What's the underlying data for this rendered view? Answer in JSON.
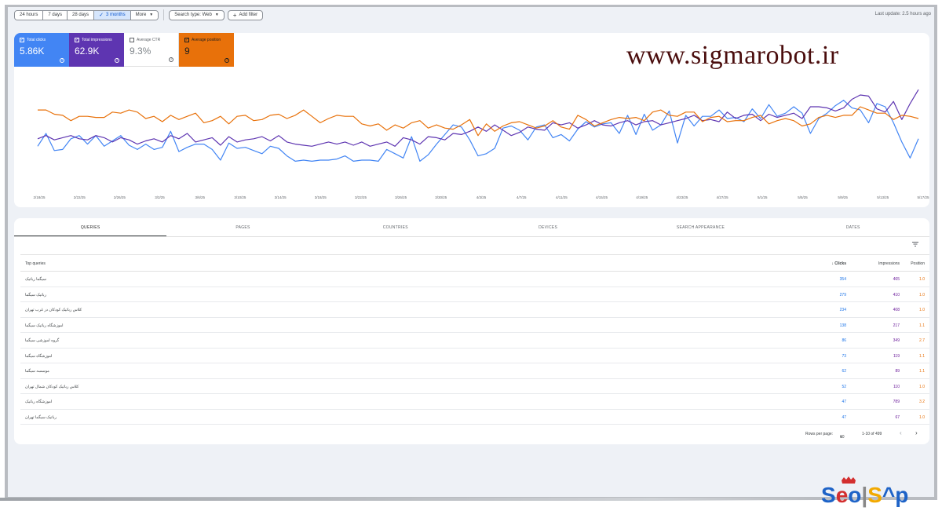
{
  "toolbar": {
    "ranges": [
      "24 hours",
      "7 days",
      "28 days",
      "3 months",
      "More"
    ],
    "active_range": "3 months",
    "search_type": "Search type: Web",
    "add_filter": "Add filter",
    "last_update": "Last update: 2.5 hours ago"
  },
  "metrics": [
    {
      "label": "Total clicks",
      "value": "5.86K",
      "color": "#4285f4",
      "checked": true
    },
    {
      "label": "Total impressions",
      "value": "62.9K",
      "color": "#5e35b1",
      "checked": true
    },
    {
      "label": "Average CTR",
      "value": "9.3%",
      "color": "#00897b",
      "checked": false
    },
    {
      "label": "Average position",
      "value": "9",
      "color": "#e8710a",
      "checked": true
    }
  ],
  "watermark": "www.sigmarobot.ir",
  "chart_data": {
    "type": "line",
    "x_tick_labels": [
      "2/18/25",
      "2/22/25",
      "2/26/25",
      "3/2/25",
      "3/6/25",
      "3/10/25",
      "3/14/25",
      "3/18/25",
      "3/22/25",
      "3/26/25",
      "3/30/25",
      "4/3/25",
      "4/7/25",
      "4/11/25",
      "4/15/25",
      "4/19/25",
      "4/23/25",
      "4/27/25",
      "5/1/25",
      "5/5/25",
      "5/9/25",
      "5/13/25",
      "5/17/25"
    ],
    "series": [
      {
        "color": "#4285f4",
        "values": [
          62,
          50,
          66,
          65,
          55,
          52,
          60,
          52,
          62,
          57,
          52,
          61,
          65,
          60,
          65,
          63,
          48,
          67,
          63,
          60,
          60,
          65,
          75,
          59,
          64,
          63,
          66,
          69,
          62,
          64,
          71,
          76,
          75,
          76,
          75,
          75,
          74,
          71,
          76,
          75,
          75,
          76,
          65,
          69,
          73,
          53,
          76,
          70,
          60,
          51,
          42,
          44,
          56,
          71,
          69,
          64,
          45,
          43,
          47,
          56,
          44,
          42,
          54,
          51,
          57,
          46,
          39,
          44,
          41,
          40,
          50,
          33,
          51,
          32,
          47,
          42,
          29,
          59,
          33,
          43,
          34,
          34,
          28,
          36,
          35,
          39,
          27,
          36,
          23,
          34,
          31,
          25,
          31,
          50,
          36,
          31,
          24,
          19,
          26,
          28,
          40,
          22,
          25,
          40,
          58,
          73,
          55
        ]
      },
      {
        "color": "#5e35b1",
        "values": [
          55,
          52,
          56,
          54,
          52,
          55,
          56,
          52,
          54,
          58,
          54,
          56,
          60,
          57,
          55,
          58,
          52,
          55,
          50,
          58,
          56,
          54,
          61,
          53,
          58,
          56,
          55,
          53,
          57,
          52,
          58,
          60,
          61,
          62,
          60,
          58,
          60,
          58,
          61,
          58,
          62,
          60,
          58,
          62,
          54,
          56,
          60,
          53,
          54,
          56,
          50,
          51,
          48,
          44,
          48,
          42,
          47,
          52,
          49,
          44,
          46,
          47,
          40,
          42,
          40,
          45,
          42,
          38,
          42,
          43,
          40,
          38,
          42,
          39,
          38,
          42,
          40,
          38,
          36,
          33,
          38,
          37,
          39,
          30,
          36,
          33,
          32,
          38,
          32,
          35,
          33,
          31,
          36,
          25,
          25,
          26,
          29,
          26,
          18,
          14,
          15,
          27,
          30,
          20,
          37,
          22,
          9
        ]
      },
      {
        "color": "#e8710a",
        "values": [
          28,
          28,
          32,
          33,
          38,
          34,
          34,
          35,
          35,
          30,
          31,
          28,
          30,
          36,
          34,
          39,
          33,
          37,
          34,
          31,
          40,
          38,
          34,
          41,
          34,
          33,
          38,
          37,
          33,
          32,
          36,
          33,
          28,
          34,
          40,
          36,
          33,
          34,
          34,
          41,
          43,
          41,
          47,
          42,
          45,
          40,
          38,
          45,
          42,
          45,
          46,
          42,
          37,
          52,
          41,
          48,
          43,
          40,
          39,
          42,
          45,
          43,
          38,
          44,
          46,
          33,
          37,
          43,
          40,
          37,
          35,
          36,
          35,
          38,
          30,
          28,
          33,
          34,
          30,
          30,
          39,
          35,
          34,
          39,
          38,
          38,
          35,
          33,
          41,
          38,
          36,
          38,
          43,
          41,
          35,
          33,
          35,
          33,
          33,
          25,
          28,
          31,
          31,
          37,
          33,
          34,
          36
        ]
      }
    ]
  },
  "tabs": [
    "QUERIES",
    "PAGES",
    "COUNTRIES",
    "DEVICES",
    "SEARCH APPEARANCE",
    "DATES"
  ],
  "table": {
    "headers": {
      "query": "Top queries",
      "clicks": "Clicks",
      "impressions": "Impressions",
      "position": "Position"
    },
    "rows": [
      {
        "query": "سیگما رباتیک",
        "clicks": "354",
        "impressions": "465",
        "position": "1.0"
      },
      {
        "query": "رباتیک سیگما",
        "clicks": "279",
        "impressions": "410",
        "position": "1.0"
      },
      {
        "query": "کلاس رباتیک کودکان در غرب تهران",
        "clicks": "234",
        "impressions": "408",
        "position": "1.0"
      },
      {
        "query": "اموزشگاه رباتیک سیگما",
        "clicks": "138",
        "impressions": "217",
        "position": "1.1"
      },
      {
        "query": "گروه اموزشی سیگما",
        "clicks": "86",
        "impressions": "349",
        "position": "2.7"
      },
      {
        "query": "اموزشگاه سیگما",
        "clicks": "73",
        "impressions": "119",
        "position": "1.1"
      },
      {
        "query": "موسسه سیگما",
        "clicks": "62",
        "impressions": "89",
        "position": "1.1"
      },
      {
        "query": "کلاس رباتیک کودکان شمال تهران",
        "clicks": "52",
        "impressions": "110",
        "position": "1.0"
      },
      {
        "query": "اموزشگاه رباتیک",
        "clicks": "47",
        "impressions": "789",
        "position": "3.2"
      },
      {
        "query": "رباتیک سیگما تهران",
        "clicks": "47",
        "impressions": "67",
        "position": "1.0"
      }
    ]
  },
  "pager": {
    "label": "Rows per page:",
    "value": "10",
    "range": "1-10 of 499"
  },
  "logo": {
    "text": "Seo|S^p"
  }
}
